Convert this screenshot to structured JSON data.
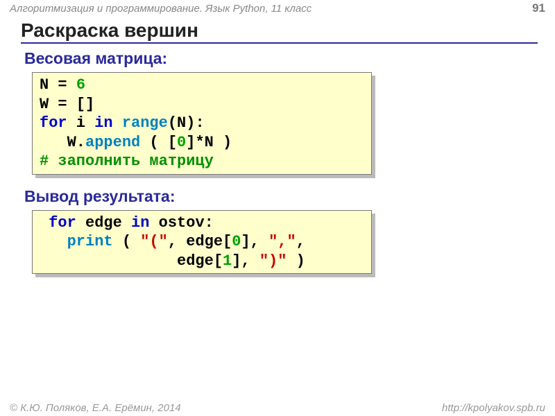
{
  "header": {
    "course": "Алгоритмизация и программирование. Язык Python, 11 класс",
    "page_number": "91"
  },
  "title": "Раскраска вершин",
  "section1_title": "Весовая матрица:",
  "section2_title": "Вывод результата:",
  "code1": {
    "l1a": "N = ",
    "l1b": "6",
    "l2": "W = []",
    "l3a": "for",
    "l3b": " i ",
    "l3c": "in",
    "l3d": " ",
    "l3e": "range",
    "l3f": "(N):",
    "l4a": "   W.",
    "l4b": "append",
    "l4c": " ( [",
    "l4d": "0",
    "l4e": "]*N )",
    "l5": "# заполнить матрицу"
  },
  "code2": {
    "l1a": " for",
    "l1b": " edge ",
    "l1c": "in",
    "l1d": " ostov:",
    "l2a": "   ",
    "l2b": "print",
    "l2c": " ( ",
    "l2d": "\"(\"",
    "l2e": ", edge[",
    "l2f": "0",
    "l2g": "], ",
    "l2h": "\",\"",
    "l2i": ",",
    "l3a": "               edge[",
    "l3b": "1",
    "l3c": "], ",
    "l3d": "\")\"",
    "l3e": " )"
  },
  "footer": {
    "authors": "© К.Ю. Поляков, Е.А. Ерёмин, 2014",
    "url": "http://kpolyakov.spb.ru"
  }
}
